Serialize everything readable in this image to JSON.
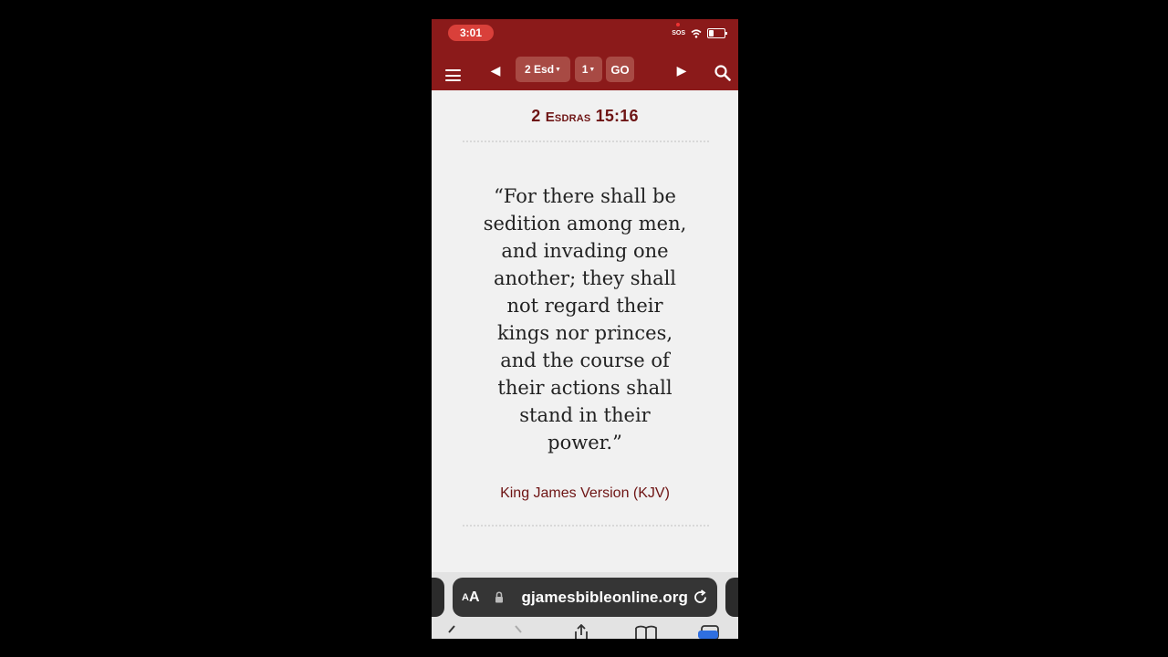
{
  "status": {
    "time": "3:01",
    "sos": "SOS"
  },
  "nav": {
    "book": "2 Esd",
    "chapter": "1",
    "go_label": "GO"
  },
  "verse": {
    "reference_number": "2 ",
    "reference_book": "Esdras",
    "reference_chapter_verse": " 15:16",
    "text": "“For there shall be sedition among men, and invading one another; they shall not regard their kings nor princes, and the course of their actions shall stand in their power.”",
    "version": "King James Version (KJV)"
  },
  "browser": {
    "aa_small": "A",
    "aa_large": "A",
    "url": "gjamesbibleonline.org"
  },
  "colors": {
    "nav_bar": "#8b1a1a",
    "accent_text": "#6e1414",
    "status_time_pill": "#d9403a"
  }
}
